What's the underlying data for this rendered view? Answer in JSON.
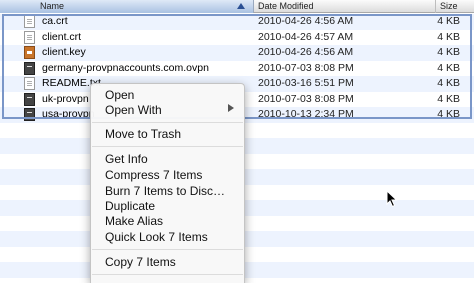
{
  "header": {
    "name_label": "Name",
    "date_label": "Date Modified",
    "size_label": "Size"
  },
  "files": [
    {
      "name": "ca.crt",
      "date": "2010-04-26 4:56 AM",
      "size": "4 KB",
      "icon": "document-icon"
    },
    {
      "name": "client.crt",
      "date": "2010-04-26 4:57 AM",
      "size": "4 KB",
      "icon": "document-icon"
    },
    {
      "name": "client.key",
      "date": "2010-04-26 4:56 AM",
      "size": "4 KB",
      "icon": "key-file-icon"
    },
    {
      "name": "germany-provpnaccounts.com.ovpn",
      "date": "2010-07-03 8:08 PM",
      "size": "4 KB",
      "icon": "ovpn-file-icon"
    },
    {
      "name": "README.txt",
      "date": "2010-03-16 5:51 PM",
      "size": "4 KB",
      "icon": "document-icon"
    },
    {
      "name": "uk-provpn",
      "date": "2010-07-03 8:08 PM",
      "size": "4 KB",
      "icon": "ovpn-file-icon"
    },
    {
      "name": "usa-provpn",
      "date": "2010-10-13 2:34 PM",
      "size": "4 KB",
      "icon": "ovpn-file-icon"
    }
  ],
  "context_menu": {
    "open": "Open",
    "open_with": "Open With",
    "move_to_trash": "Move to Trash",
    "get_info": "Get Info",
    "compress": "Compress 7 Items",
    "burn": "Burn 7 Items to Disc…",
    "duplicate": "Duplicate",
    "make_alias": "Make Alias",
    "quick_look": "Quick Look 7 Items",
    "copy": "Copy 7 Items"
  },
  "colors": {
    "selection_outline": "#7a96c8",
    "alt_row": "#edf3fe",
    "sort_arrow": "#2a4f93"
  }
}
